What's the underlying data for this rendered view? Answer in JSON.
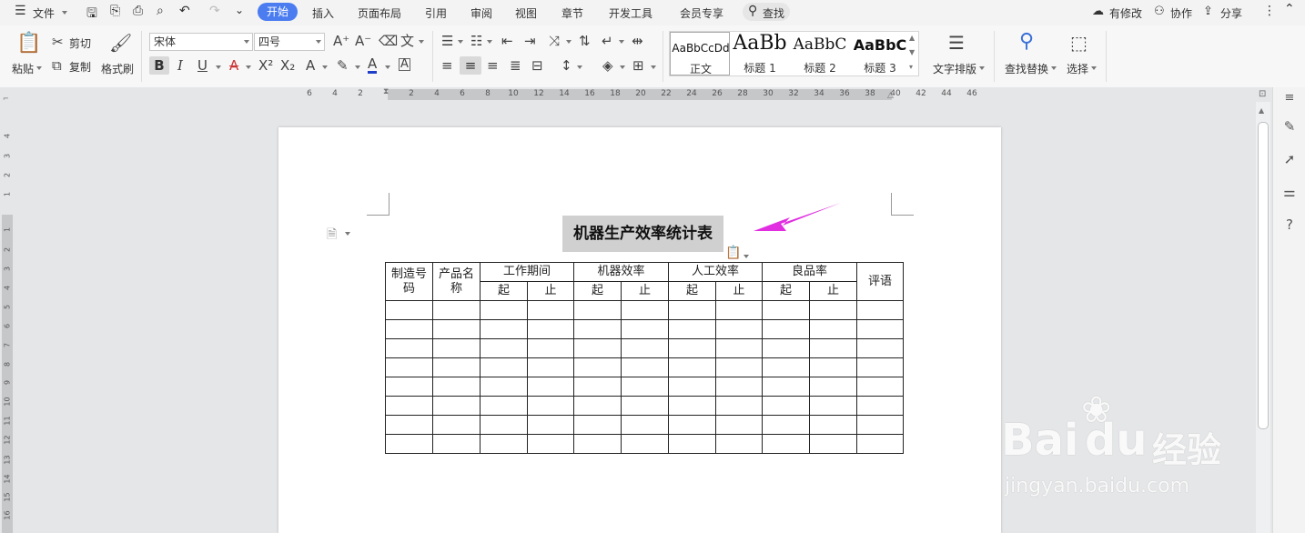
{
  "menu": {
    "items": [
      "文件",
      "插入",
      "页面布局",
      "引用",
      "审阅",
      "视图",
      "章节",
      "开发工具",
      "会员专享"
    ],
    "active_tab": "开始",
    "search_label": "查找",
    "right": {
      "modified": "有修改",
      "collab": "协作",
      "share": "分享"
    }
  },
  "toolbar": {
    "paste": "粘贴",
    "cut": "剪切",
    "copy": "复制",
    "format_painter": "格式刷",
    "font_name": "宋体",
    "font_size": "四号",
    "text_layout": "文字排版",
    "find_replace": "查找替换",
    "select": "选择",
    "styles": [
      {
        "preview": "AaBbCcDd",
        "label": "正文"
      },
      {
        "preview": "AaBb",
        "label": "标题 1"
      },
      {
        "preview": "AaBbC",
        "label": "标题 2"
      },
      {
        "preview": "AaBbC",
        "label": "标题 3"
      }
    ]
  },
  "ruler": {
    "h_ticks": [
      "6",
      "4",
      "2",
      "2",
      "4",
      "6",
      "8",
      "10",
      "12",
      "14",
      "16",
      "18",
      "20",
      "22",
      "24",
      "26",
      "28",
      "30",
      "32",
      "34",
      "36",
      "38",
      "40",
      "42",
      "44",
      "46"
    ],
    "v_ticks": [
      "4",
      "3",
      "2",
      "1",
      "1",
      "2",
      "3",
      "4",
      "5",
      "6",
      "7",
      "8",
      "9",
      "10",
      "11",
      "12",
      "13",
      "14",
      "15",
      "16"
    ]
  },
  "document": {
    "title": "机器生产效率统计表",
    "table": {
      "h_mfg_no": "制造号码",
      "h_product": "产品名称",
      "h_period": "工作期间",
      "h_machine_eff": "机器效率",
      "h_labor_eff": "人工效率",
      "h_yield": "良品率",
      "h_remarks": "评语",
      "start": "起",
      "end": "止",
      "empty_rows": 8
    }
  },
  "watermark": {
    "brand": "Bai",
    "brand2": "du",
    "site_cn": "经验",
    "url": "jingyan.baidu.com"
  },
  "colors": {
    "accent": "#4b7df0",
    "arrow": "#e02ee0",
    "selection": "#d0d0d0",
    "font_color": "#1e3ec8"
  }
}
